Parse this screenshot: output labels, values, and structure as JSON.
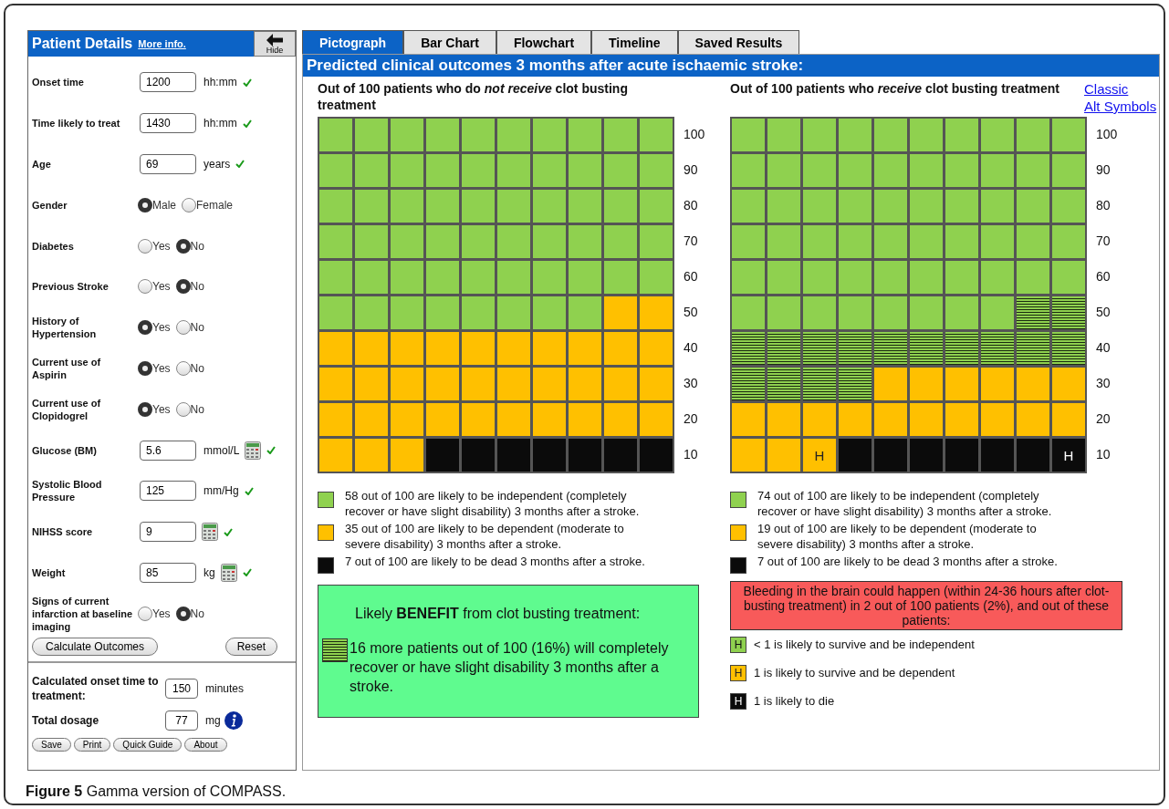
{
  "patient_panel": {
    "title": "Patient Details",
    "more_info": "More info.",
    "hide_button": "Hide",
    "fields": [
      {
        "kind": "input",
        "label": "Onset time",
        "value": "1200",
        "unit": "hh:mm",
        "calculator": false,
        "valid": true
      },
      {
        "kind": "input",
        "label": "Time likely to treat",
        "value": "1430",
        "unit": "hh:mm",
        "calculator": false,
        "valid": true
      },
      {
        "kind": "input",
        "label": "Age",
        "value": "69",
        "unit": "years",
        "calculator": false,
        "valid": true
      },
      {
        "kind": "radio",
        "label": "Gender",
        "options": [
          {
            "label": "Male",
            "selected": true
          },
          {
            "label": "Female",
            "selected": false
          }
        ]
      },
      {
        "kind": "radio",
        "label": "Diabetes",
        "options": [
          {
            "label": "Yes",
            "selected": false
          },
          {
            "label": "No",
            "selected": true
          }
        ]
      },
      {
        "kind": "radio",
        "label": "Previous Stroke",
        "options": [
          {
            "label": "Yes",
            "selected": false
          },
          {
            "label": "No",
            "selected": true
          }
        ]
      },
      {
        "kind": "radio",
        "label": "History of Hypertension",
        "options": [
          {
            "label": "Yes",
            "selected": true
          },
          {
            "label": "No",
            "selected": false
          }
        ]
      },
      {
        "kind": "radio",
        "label": "Current use of Aspirin",
        "options": [
          {
            "label": "Yes",
            "selected": true
          },
          {
            "label": "No",
            "selected": false
          }
        ]
      },
      {
        "kind": "radio",
        "label": "Current use of Clopidogrel",
        "options": [
          {
            "label": "Yes",
            "selected": true
          },
          {
            "label": "No",
            "selected": false
          }
        ]
      },
      {
        "kind": "input",
        "label": "Glucose (BM)",
        "value": "5.6",
        "unit": "mmol/L",
        "calculator": true,
        "valid": true
      },
      {
        "kind": "input",
        "label": "Systolic Blood Pressure",
        "value": "125",
        "unit": "mm/Hg",
        "calculator": false,
        "valid": true
      },
      {
        "kind": "input",
        "label": "NIHSS score",
        "value": "9",
        "calculator": true,
        "valid": true
      },
      {
        "kind": "input",
        "label": "Weight",
        "value": "85",
        "unit": "kg",
        "calculator": true,
        "valid": true
      },
      {
        "kind": "radio",
        "label": "Signs of current infarction at baseline imaging",
        "options": [
          {
            "label": "Yes",
            "selected": false
          },
          {
            "label": "No",
            "selected": true
          }
        ]
      }
    ],
    "actions": [
      "Calculate Outcomes",
      "Reset"
    ],
    "results": [
      {
        "label": "Calculated onset time to treatment:",
        "value": "150",
        "unit": "minutes",
        "info": false
      },
      {
        "label": "Total dosage",
        "value": "77",
        "unit": "mg",
        "info": true
      }
    ],
    "footer_buttons": [
      "Save",
      "Print",
      "Quick Guide",
      "About"
    ]
  },
  "tabs": [
    {
      "label": "Pictograph",
      "selected": true
    },
    {
      "label": "Bar Chart",
      "selected": false
    },
    {
      "label": "Flowchart",
      "selected": false
    },
    {
      "label": "Timeline",
      "selected": false
    },
    {
      "label": "Saved Results",
      "selected": false
    }
  ],
  "banner": "Predicted clinical outcomes 3 months after acute ischaemic stroke:",
  "links": [
    "Classic",
    "Alt Symbols"
  ],
  "pictographs": [
    {
      "heading": "Out of 100 patients who do *not receive* clot busting treatment",
      "rows": [
        {
          "label": "100",
          "cells": [
            {
              "kind": "independent"
            },
            {
              "kind": "independent"
            },
            {
              "kind": "independent"
            },
            {
              "kind": "independent"
            },
            {
              "kind": "independent"
            },
            {
              "kind": "independent"
            },
            {
              "kind": "independent"
            },
            {
              "kind": "independent"
            },
            {
              "kind": "independent"
            },
            {
              "kind": "independent"
            }
          ]
        },
        {
          "label": "90",
          "cells": [
            {
              "kind": "independent"
            },
            {
              "kind": "independent"
            },
            {
              "kind": "independent"
            },
            {
              "kind": "independent"
            },
            {
              "kind": "independent"
            },
            {
              "kind": "independent"
            },
            {
              "kind": "independent"
            },
            {
              "kind": "independent"
            },
            {
              "kind": "independent"
            },
            {
              "kind": "independent"
            }
          ]
        },
        {
          "label": "80",
          "cells": [
            {
              "kind": "independent"
            },
            {
              "kind": "independent"
            },
            {
              "kind": "independent"
            },
            {
              "kind": "independent"
            },
            {
              "kind": "independent"
            },
            {
              "kind": "independent"
            },
            {
              "kind": "independent"
            },
            {
              "kind": "independent"
            },
            {
              "kind": "independent"
            },
            {
              "kind": "independent"
            }
          ]
        },
        {
          "label": "70",
          "cells": [
            {
              "kind": "independent"
            },
            {
              "kind": "independent"
            },
            {
              "kind": "independent"
            },
            {
              "kind": "independent"
            },
            {
              "kind": "independent"
            },
            {
              "kind": "independent"
            },
            {
              "kind": "independent"
            },
            {
              "kind": "independent"
            },
            {
              "kind": "independent"
            },
            {
              "kind": "independent"
            }
          ]
        },
        {
          "label": "60",
          "cells": [
            {
              "kind": "independent"
            },
            {
              "kind": "independent"
            },
            {
              "kind": "independent"
            },
            {
              "kind": "independent"
            },
            {
              "kind": "independent"
            },
            {
              "kind": "independent"
            },
            {
              "kind": "independent"
            },
            {
              "kind": "independent"
            },
            {
              "kind": "independent"
            },
            {
              "kind": "independent"
            }
          ]
        },
        {
          "label": "50",
          "cells": [
            {
              "kind": "independent"
            },
            {
              "kind": "independent"
            },
            {
              "kind": "independent"
            },
            {
              "kind": "independent"
            },
            {
              "kind": "independent"
            },
            {
              "kind": "independent"
            },
            {
              "kind": "independent"
            },
            {
              "kind": "independent"
            },
            {
              "kind": "dependent"
            },
            {
              "kind": "dependent"
            }
          ]
        },
        {
          "label": "40",
          "cells": [
            {
              "kind": "dependent"
            },
            {
              "kind": "dependent"
            },
            {
              "kind": "dependent"
            },
            {
              "kind": "dependent"
            },
            {
              "kind": "dependent"
            },
            {
              "kind": "dependent"
            },
            {
              "kind": "dependent"
            },
            {
              "kind": "dependent"
            },
            {
              "kind": "dependent"
            },
            {
              "kind": "dependent"
            }
          ]
        },
        {
          "label": "30",
          "cells": [
            {
              "kind": "dependent"
            },
            {
              "kind": "dependent"
            },
            {
              "kind": "dependent"
            },
            {
              "kind": "dependent"
            },
            {
              "kind": "dependent"
            },
            {
              "kind": "dependent"
            },
            {
              "kind": "dependent"
            },
            {
              "kind": "dependent"
            },
            {
              "kind": "dependent"
            },
            {
              "kind": "dependent"
            }
          ]
        },
        {
          "label": "20",
          "cells": [
            {
              "kind": "dependent"
            },
            {
              "kind": "dependent"
            },
            {
              "kind": "dependent"
            },
            {
              "kind": "dependent"
            },
            {
              "kind": "dependent"
            },
            {
              "kind": "dependent"
            },
            {
              "kind": "dependent"
            },
            {
              "kind": "dependent"
            },
            {
              "kind": "dependent"
            },
            {
              "kind": "dependent"
            }
          ]
        },
        {
          "label": "10",
          "cells": [
            {
              "kind": "dependent"
            },
            {
              "kind": "dependent"
            },
            {
              "kind": "dependent"
            },
            {
              "kind": "dead"
            },
            {
              "kind": "dead"
            },
            {
              "kind": "dead"
            },
            {
              "kind": "dead"
            },
            {
              "kind": "dead"
            },
            {
              "kind": "dead"
            },
            {
              "kind": "dead"
            }
          ]
        }
      ],
      "legend": [
        {
          "kind": "independent",
          "text": "58 out of 100 are likely to be independent (completely recover or have slight disability) 3 months after a stroke."
        },
        {
          "kind": "dependent",
          "text": "35 out of 100 are likely to be dependent (moderate to severe disability) 3 months after a stroke."
        },
        {
          "kind": "dead",
          "text": "7 out of 100 are likely to be dead 3 months after a stroke."
        }
      ]
    },
    {
      "heading": "Out of 100 patients who *receive* clot busting treatment",
      "rows": [
        {
          "label": "100",
          "cells": [
            {
              "kind": "independent"
            },
            {
              "kind": "independent"
            },
            {
              "kind": "independent"
            },
            {
              "kind": "independent"
            },
            {
              "kind": "independent"
            },
            {
              "kind": "independent"
            },
            {
              "kind": "independent"
            },
            {
              "kind": "independent"
            },
            {
              "kind": "independent"
            },
            {
              "kind": "independent"
            }
          ]
        },
        {
          "label": "90",
          "cells": [
            {
              "kind": "independent"
            },
            {
              "kind": "independent"
            },
            {
              "kind": "independent"
            },
            {
              "kind": "independent"
            },
            {
              "kind": "independent"
            },
            {
              "kind": "independent"
            },
            {
              "kind": "independent"
            },
            {
              "kind": "independent"
            },
            {
              "kind": "independent"
            },
            {
              "kind": "independent"
            }
          ]
        },
        {
          "label": "80",
          "cells": [
            {
              "kind": "independent"
            },
            {
              "kind": "independent"
            },
            {
              "kind": "independent"
            },
            {
              "kind": "independent"
            },
            {
              "kind": "independent"
            },
            {
              "kind": "independent"
            },
            {
              "kind": "independent"
            },
            {
              "kind": "independent"
            },
            {
              "kind": "independent"
            },
            {
              "kind": "independent"
            }
          ]
        },
        {
          "label": "70",
          "cells": [
            {
              "kind": "independent"
            },
            {
              "kind": "independent"
            },
            {
              "kind": "independent"
            },
            {
              "kind": "independent"
            },
            {
              "kind": "independent"
            },
            {
              "kind": "independent"
            },
            {
              "kind": "independent"
            },
            {
              "kind": "independent"
            },
            {
              "kind": "independent"
            },
            {
              "kind": "independent"
            }
          ]
        },
        {
          "label": "60",
          "cells": [
            {
              "kind": "independent"
            },
            {
              "kind": "independent"
            },
            {
              "kind": "independent"
            },
            {
              "kind": "independent"
            },
            {
              "kind": "independent"
            },
            {
              "kind": "independent"
            },
            {
              "kind": "independent"
            },
            {
              "kind": "independent"
            },
            {
              "kind": "independent"
            },
            {
              "kind": "independent"
            }
          ]
        },
        {
          "label": "50",
          "cells": [
            {
              "kind": "independent"
            },
            {
              "kind": "independent"
            },
            {
              "kind": "independent"
            },
            {
              "kind": "independent"
            },
            {
              "kind": "independent"
            },
            {
              "kind": "independent"
            },
            {
              "kind": "independent"
            },
            {
              "kind": "independent"
            },
            {
              "kind": "benefit"
            },
            {
              "kind": "benefit"
            }
          ]
        },
        {
          "label": "40",
          "cells": [
            {
              "kind": "benefit"
            },
            {
              "kind": "benefit"
            },
            {
              "kind": "benefit"
            },
            {
              "kind": "benefit"
            },
            {
              "kind": "benefit"
            },
            {
              "kind": "benefit"
            },
            {
              "kind": "benefit"
            },
            {
              "kind": "benefit"
            },
            {
              "kind": "benefit"
            },
            {
              "kind": "benefit"
            }
          ]
        },
        {
          "label": "30",
          "cells": [
            {
              "kind": "benefit"
            },
            {
              "kind": "benefit"
            },
            {
              "kind": "benefit"
            },
            {
              "kind": "benefit"
            },
            {
              "kind": "dependent"
            },
            {
              "kind": "dependent"
            },
            {
              "kind": "dependent"
            },
            {
              "kind": "dependent"
            },
            {
              "kind": "dependent"
            },
            {
              "kind": "dependent"
            }
          ]
        },
        {
          "label": "20",
          "cells": [
            {
              "kind": "dependent"
            },
            {
              "kind": "dependent"
            },
            {
              "kind": "dependent"
            },
            {
              "kind": "dependent"
            },
            {
              "kind": "dependent"
            },
            {
              "kind": "dependent"
            },
            {
              "kind": "dependent"
            },
            {
              "kind": "dependent"
            },
            {
              "kind": "dependent"
            },
            {
              "kind": "dependent"
            }
          ]
        },
        {
          "label": "10",
          "cells": [
            {
              "kind": "dependent"
            },
            {
              "kind": "dependent"
            },
            {
              "kind": "dependent",
              "text": "H"
            },
            {
              "kind": "dead"
            },
            {
              "kind": "dead"
            },
            {
              "kind": "dead"
            },
            {
              "kind": "dead"
            },
            {
              "kind": "dead"
            },
            {
              "kind": "dead"
            },
            {
              "kind": "dead",
              "text": "H"
            }
          ]
        }
      ],
      "legend": [
        {
          "kind": "independent",
          "text": "74 out of 100 are likely to be independent (completely recover or have slight disability) 3 months after a stroke."
        },
        {
          "kind": "dependent",
          "text": "19 out of 100 are likely to be dependent (moderate to severe disability) 3 months after a stroke."
        },
        {
          "kind": "dead",
          "text": "7 out of 100 are likely to be dead 3 months after a stroke."
        }
      ]
    }
  ],
  "benefit_box": {
    "title": "Likely **BENEFIT** from clot busting treatment:",
    "text": "16 more patients out of 100 (16%) will completely recover or have slight disability 3 months after a stroke."
  },
  "bleeding_box": {
    "text": "Bleeding in the brain could happen (within 24-36 hours after clot-busting treatment) in 2 out of 100 patients (2%), and out of these patients:",
    "items": [
      {
        "kind": "independent",
        "icon_text": "H",
        "text": "< 1 is likely to survive and be independent"
      },
      {
        "kind": "dependent",
        "icon_text": "H",
        "text": "1 is likely to survive and be dependent"
      },
      {
        "kind": "dead",
        "icon_text": "H",
        "text": "1 is likely to die"
      }
    ]
  },
  "caption": {
    "label": "Figure 5",
    "text": "Gamma version of COMPASS."
  }
}
